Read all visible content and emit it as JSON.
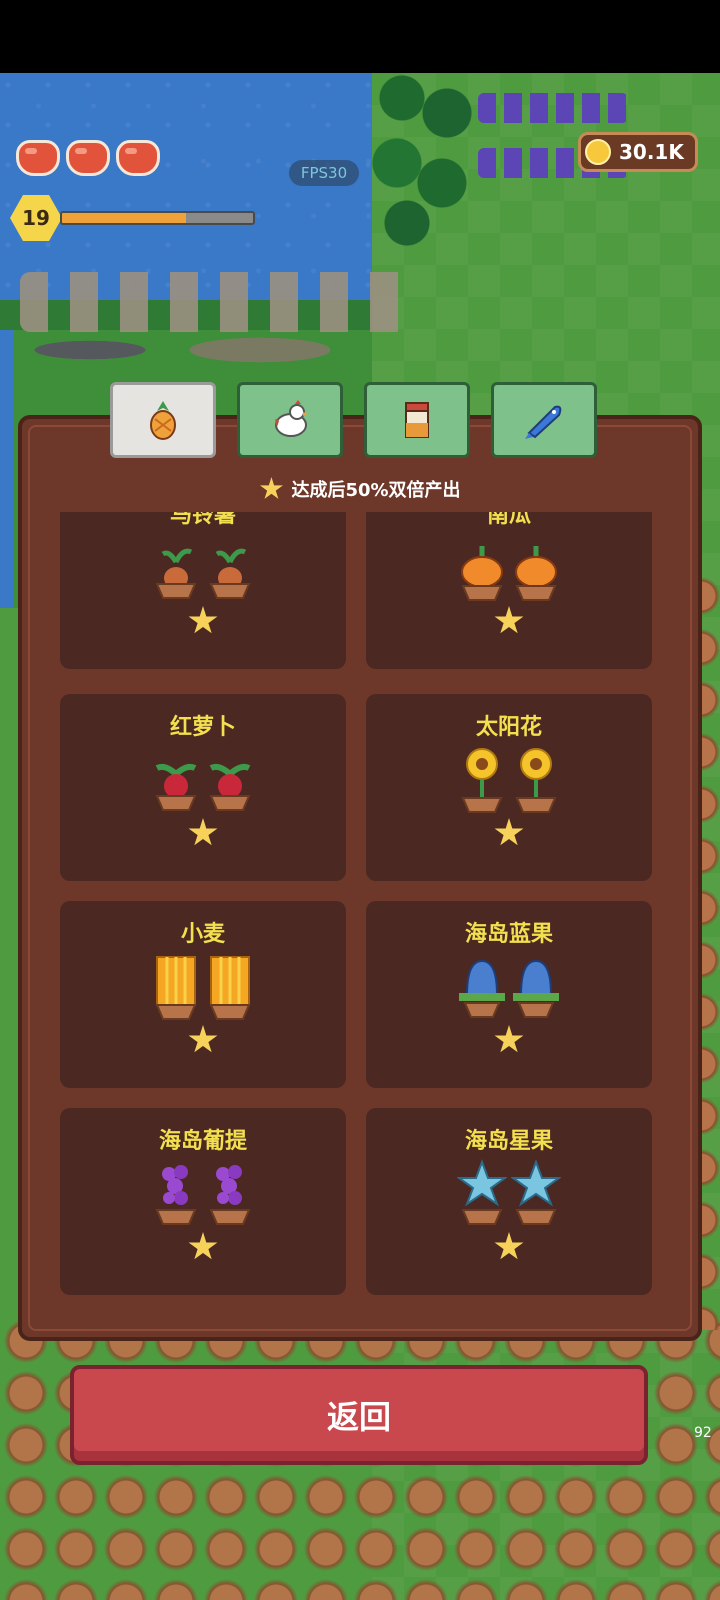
{
  "hud": {
    "hearts": 3,
    "level": "19",
    "xp_progress": 0.65,
    "fps": "FPS30",
    "coins": "30.1K",
    "side_number": "92"
  },
  "tabs": [
    {
      "name": "crops",
      "icon": "pineapple-icon",
      "active": true
    },
    {
      "name": "animals",
      "icon": "chicken-icon",
      "active": false
    },
    {
      "name": "products",
      "icon": "jar-icon",
      "active": false
    },
    {
      "name": "fish",
      "icon": "fish-icon",
      "active": false
    }
  ],
  "panel": {
    "bonus_text": "达成后50%双倍产出",
    "items": [
      {
        "name": "马铃薯",
        "icon": "potato-sprout-icon"
      },
      {
        "name": "南瓜",
        "icon": "pumpkin-icon"
      },
      {
        "name": "红萝卜",
        "icon": "radish-icon"
      },
      {
        "name": "太阳花",
        "icon": "sunflower-icon"
      },
      {
        "name": "小麦",
        "icon": "wheat-icon"
      },
      {
        "name": "海岛蓝果",
        "icon": "island-blueberry-icon"
      },
      {
        "name": "海岛葡提",
        "icon": "island-grape-icon"
      },
      {
        "name": "海岛星果",
        "icon": "island-starfruit-icon"
      }
    ]
  },
  "back_button": {
    "label": "返回"
  },
  "colors": {
    "panel": "#6d3729",
    "card": "#4b2922",
    "item_name": "#f3e04f",
    "back_button": "#c8484e",
    "tab_inactive": "#7ec18a"
  }
}
